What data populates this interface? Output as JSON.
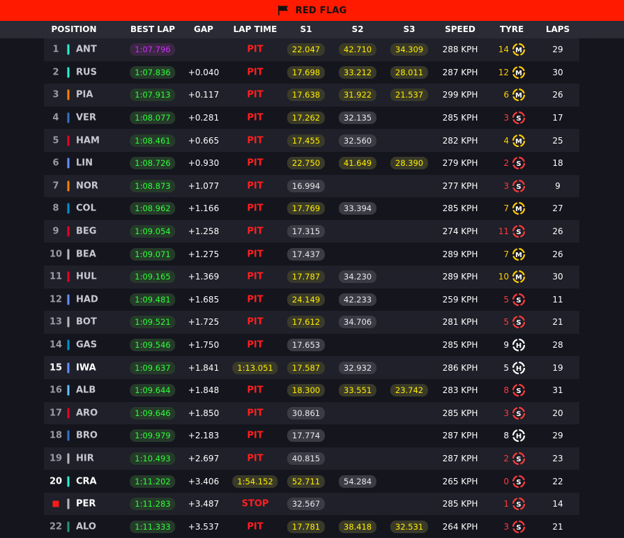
{
  "banner": {
    "text": "RED FLAG",
    "icon": "flag-icon"
  },
  "columns": [
    "POSITION",
    "BEST LAP",
    "GAP",
    "LAP TIME",
    "S1",
    "S2",
    "S3",
    "SPEED",
    "TYRE",
    "LAPS"
  ],
  "colors": {
    "banner": "#ff1a00",
    "fastest": "#d22cff",
    "personal_best": "#2dff3a",
    "sector_yellow": "#ffee00",
    "pit_red": "#ff1f1f",
    "tyre_medium": "#ffcc00",
    "tyre_soft": "#ff3b3b",
    "tyre_hard": "#ffffff"
  },
  "rows": [
    {
      "pos": "1",
      "code": "ANT",
      "team_color": "#27f4d2",
      "best_lap": "1:07.796",
      "best_lap_style": "purple",
      "gap": "",
      "lap_time": "PIT",
      "lap_time_style": "text",
      "s1": "22.047",
      "s1_style": "yellow",
      "s2": "42.710",
      "s2_style": "yellow",
      "s3": "34.309",
      "s3_style": "yellow",
      "speed": "288 KPH",
      "tyre_laps": "14",
      "tyre": "M",
      "laps": "29"
    },
    {
      "pos": "2",
      "code": "RUS",
      "team_color": "#27f4d2",
      "best_lap": "1:07.836",
      "best_lap_style": "green",
      "gap": "+0.040",
      "lap_time": "PIT",
      "lap_time_style": "text",
      "s1": "17.698",
      "s1_style": "yellow",
      "s2": "33.212",
      "s2_style": "yellow",
      "s3": "28.011",
      "s3_style": "yellow",
      "speed": "287 KPH",
      "tyre_laps": "12",
      "tyre": "M",
      "laps": "30"
    },
    {
      "pos": "3",
      "code": "PIA",
      "team_color": "#ff8000",
      "best_lap": "1:07.913",
      "best_lap_style": "green",
      "gap": "+0.117",
      "lap_time": "PIT",
      "lap_time_style": "text",
      "s1": "17.638",
      "s1_style": "yellow",
      "s2": "31.922",
      "s2_style": "yellow",
      "s3": "21.537",
      "s3_style": "yellow",
      "speed": "299 KPH",
      "tyre_laps": "6",
      "tyre": "M",
      "laps": "26"
    },
    {
      "pos": "4",
      "code": "VER",
      "team_color": "#3671c6",
      "best_lap": "1:08.077",
      "best_lap_style": "green",
      "gap": "+0.281",
      "lap_time": "PIT",
      "lap_time_style": "text",
      "s1": "17.262",
      "s1_style": "yellow",
      "s2": "32.135",
      "s2_style": "white",
      "s3": "",
      "s3_style": "",
      "speed": "285 KPH",
      "tyre_laps": "3",
      "tyre": "S",
      "laps": "17"
    },
    {
      "pos": "5",
      "code": "HAM",
      "team_color": "#e8002d",
      "best_lap": "1:08.461",
      "best_lap_style": "green",
      "gap": "+0.665",
      "lap_time": "PIT",
      "lap_time_style": "text",
      "s1": "17.455",
      "s1_style": "yellow",
      "s2": "32.560",
      "s2_style": "white",
      "s3": "",
      "s3_style": "",
      "speed": "282 KPH",
      "tyre_laps": "4",
      "tyre": "M",
      "laps": "25"
    },
    {
      "pos": "6",
      "code": "LIN",
      "team_color": "#6692ff",
      "best_lap": "1:08.726",
      "best_lap_style": "green",
      "gap": "+0.930",
      "lap_time": "PIT",
      "lap_time_style": "text",
      "s1": "22.750",
      "s1_style": "yellow",
      "s2": "41.649",
      "s2_style": "yellow",
      "s3": "28.390",
      "s3_style": "yellow",
      "speed": "279 KPH",
      "tyre_laps": "2",
      "tyre": "S",
      "laps": "18"
    },
    {
      "pos": "7",
      "code": "NOR",
      "team_color": "#ff8000",
      "best_lap": "1:08.873",
      "best_lap_style": "green",
      "gap": "+1.077",
      "lap_time": "PIT",
      "lap_time_style": "text",
      "s1": "16.994",
      "s1_style": "white",
      "s2": "",
      "s2_style": "",
      "s3": "",
      "s3_style": "",
      "speed": "277 KPH",
      "tyre_laps": "3",
      "tyre": "S",
      "laps": "9"
    },
    {
      "pos": "8",
      "code": "COL",
      "team_color": "#0093cc",
      "best_lap": "1:08.962",
      "best_lap_style": "green",
      "gap": "+1.166",
      "lap_time": "PIT",
      "lap_time_style": "text",
      "s1": "17.769",
      "s1_style": "yellow",
      "s2": "33.394",
      "s2_style": "white",
      "s3": "",
      "s3_style": "",
      "speed": "285 KPH",
      "tyre_laps": "7",
      "tyre": "M",
      "laps": "27"
    },
    {
      "pos": "9",
      "code": "BEG",
      "team_color": "#e8002d",
      "best_lap": "1:09.054",
      "best_lap_style": "green",
      "gap": "+1.258",
      "lap_time": "PIT",
      "lap_time_style": "text",
      "s1": "17.315",
      "s1_style": "white",
      "s2": "",
      "s2_style": "",
      "s3": "",
      "s3_style": "",
      "speed": "274 KPH",
      "tyre_laps": "11",
      "tyre": "S",
      "laps": "26"
    },
    {
      "pos": "10",
      "code": "BEA",
      "team_color": "#b6babd",
      "best_lap": "1:09.071",
      "best_lap_style": "green",
      "gap": "+1.275",
      "lap_time": "PIT",
      "lap_time_style": "text",
      "s1": "17.437",
      "s1_style": "white",
      "s2": "",
      "s2_style": "",
      "s3": "",
      "s3_style": "",
      "speed": "289 KPH",
      "tyre_laps": "7",
      "tyre": "M",
      "laps": "26"
    },
    {
      "pos": "11",
      "code": "HUL",
      "team_color": "#e8002d",
      "best_lap": "1:09.165",
      "best_lap_style": "green",
      "gap": "+1.369",
      "lap_time": "PIT",
      "lap_time_style": "text",
      "s1": "17.787",
      "s1_style": "yellow",
      "s2": "34.230",
      "s2_style": "white",
      "s3": "",
      "s3_style": "",
      "speed": "289 KPH",
      "tyre_laps": "10",
      "tyre": "M",
      "laps": "30"
    },
    {
      "pos": "12",
      "code": "HAD",
      "team_color": "#6692ff",
      "best_lap": "1:09.481",
      "best_lap_style": "green",
      "gap": "+1.685",
      "lap_time": "PIT",
      "lap_time_style": "text",
      "s1": "24.149",
      "s1_style": "yellow",
      "s2": "42.233",
      "s2_style": "white",
      "s3": "",
      "s3_style": "",
      "speed": "259 KPH",
      "tyre_laps": "5",
      "tyre": "S",
      "laps": "11"
    },
    {
      "pos": "13",
      "code": "BOT",
      "team_color": "#b6babd",
      "best_lap": "1:09.521",
      "best_lap_style": "green",
      "gap": "+1.725",
      "lap_time": "PIT",
      "lap_time_style": "text",
      "s1": "17.612",
      "s1_style": "yellow",
      "s2": "34.706",
      "s2_style": "white",
      "s3": "",
      "s3_style": "",
      "speed": "281 KPH",
      "tyre_laps": "5",
      "tyre": "S",
      "laps": "21"
    },
    {
      "pos": "14",
      "code": "GAS",
      "team_color": "#0093cc",
      "best_lap": "1:09.546",
      "best_lap_style": "green",
      "gap": "+1.750",
      "lap_time": "PIT",
      "lap_time_style": "text",
      "s1": "17.653",
      "s1_style": "white",
      "s2": "",
      "s2_style": "",
      "s3": "",
      "s3_style": "",
      "speed": "285 KPH",
      "tyre_laps": "9",
      "tyre": "H",
      "laps": "28"
    },
    {
      "pos": "15",
      "code": "IWA",
      "team_color": "#6692ff",
      "best_lap": "1:09.637",
      "best_lap_style": "green",
      "gap": "+1.841",
      "lap_time": "1:13.051",
      "lap_time_style": "yellow",
      "s1": "17.587",
      "s1_style": "yellow",
      "s2": "32.932",
      "s2_style": "white",
      "s3": "",
      "s3_style": "",
      "speed": "286 KPH",
      "tyre_laps": "5",
      "tyre": "H",
      "laps": "19",
      "highlight": true
    },
    {
      "pos": "16",
      "code": "ALB",
      "team_color": "#64c4ff",
      "best_lap": "1:09.644",
      "best_lap_style": "green",
      "gap": "+1.848",
      "lap_time": "PIT",
      "lap_time_style": "text",
      "s1": "18.300",
      "s1_style": "yellow",
      "s2": "33.551",
      "s2_style": "yellow",
      "s3": "23.742",
      "s3_style": "yellow",
      "speed": "283 KPH",
      "tyre_laps": "8",
      "tyre": "S",
      "laps": "31"
    },
    {
      "pos": "17",
      "code": "ARO",
      "team_color": "#e8002d",
      "best_lap": "1:09.646",
      "best_lap_style": "green",
      "gap": "+1.850",
      "lap_time": "PIT",
      "lap_time_style": "text",
      "s1": "30.861",
      "s1_style": "white",
      "s2": "",
      "s2_style": "",
      "s3": "",
      "s3_style": "",
      "speed": "285 KPH",
      "tyre_laps": "3",
      "tyre": "S",
      "laps": "20"
    },
    {
      "pos": "18",
      "code": "BRO",
      "team_color": "#3671c6",
      "best_lap": "1:09.979",
      "best_lap_style": "green",
      "gap": "+2.183",
      "lap_time": "PIT",
      "lap_time_style": "text",
      "s1": "17.774",
      "s1_style": "white",
      "s2": "",
      "s2_style": "",
      "s3": "",
      "s3_style": "",
      "speed": "287 KPH",
      "tyre_laps": "8",
      "tyre": "H",
      "laps": "29"
    },
    {
      "pos": "19",
      "code": "HIR",
      "team_color": "#b6babd",
      "best_lap": "1:10.493",
      "best_lap_style": "green",
      "gap": "+2.697",
      "lap_time": "PIT",
      "lap_time_style": "text",
      "s1": "40.815",
      "s1_style": "white",
      "s2": "",
      "s2_style": "",
      "s3": "",
      "s3_style": "",
      "speed": "287 KPH",
      "tyre_laps": "2",
      "tyre": "S",
      "laps": "23"
    },
    {
      "pos": "20",
      "code": "CRA",
      "team_color": "#27f4d2",
      "best_lap": "1:11.202",
      "best_lap_style": "green",
      "gap": "+3.406",
      "lap_time": "1:54.152",
      "lap_time_style": "yellow",
      "s1": "52.711",
      "s1_style": "yellow",
      "s2": "54.284",
      "s2_style": "white",
      "s3": "",
      "s3_style": "",
      "speed": "265 KPH",
      "tyre_laps": "0",
      "tyre": "S",
      "laps": "22",
      "highlight": true
    },
    {
      "pos": "",
      "stopped": true,
      "code": "PER",
      "team_color": "#b6babd",
      "best_lap": "1:11.283",
      "best_lap_style": "green",
      "gap": "+3.487",
      "lap_time": "STOP",
      "lap_time_style": "text",
      "s1": "32.567",
      "s1_style": "white",
      "s2": "",
      "s2_style": "",
      "s3": "",
      "s3_style": "",
      "speed": "285 KPH",
      "tyre_laps": "1",
      "tyre": "S",
      "laps": "14",
      "highlight": true
    },
    {
      "pos": "22",
      "code": "ALO",
      "team_color": "#229971",
      "best_lap": "1:11.333",
      "best_lap_style": "green",
      "gap": "+3.537",
      "lap_time": "PIT",
      "lap_time_style": "text",
      "s1": "17.781",
      "s1_style": "yellow",
      "s2": "38.418",
      "s2_style": "yellow",
      "s3": "32.531",
      "s3_style": "yellow",
      "speed": "264 KPH",
      "tyre_laps": "3",
      "tyre": "S",
      "laps": "21"
    }
  ]
}
